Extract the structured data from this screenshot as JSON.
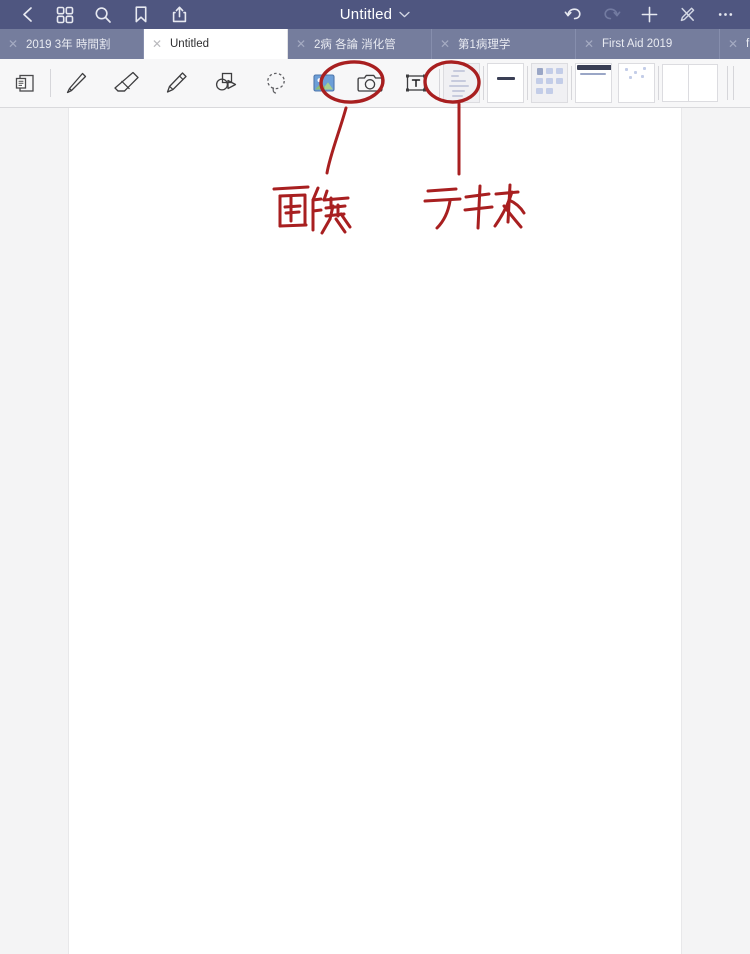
{
  "app": {
    "name": "Notability",
    "accent_topbar": "#4f5680",
    "accent_tabbar": "#757d9d",
    "annotation_color": "#b3201f"
  },
  "topbar": {
    "title": "Untitled",
    "title_chevron": "chevron-down-icon",
    "left_actions": [
      {
        "name": "back-button",
        "icon": "chevron-left-icon",
        "label": "Back"
      },
      {
        "name": "thumbnails-button",
        "icon": "grid-icon",
        "label": "Thumbnails"
      },
      {
        "name": "search-button",
        "icon": "search-icon",
        "label": "Search"
      },
      {
        "name": "bookmark-button",
        "icon": "bookmark-icon",
        "label": "Bookmark"
      },
      {
        "name": "share-button",
        "icon": "share-icon",
        "label": "Share"
      }
    ],
    "right_actions": [
      {
        "name": "undo-button",
        "icon": "undo-icon",
        "label": "Undo",
        "enabled": true
      },
      {
        "name": "redo-button",
        "icon": "redo-icon",
        "label": "Redo",
        "enabled": false
      },
      {
        "name": "add-button",
        "icon": "plus-icon",
        "label": "New Note"
      },
      {
        "name": "palm-rejection-button",
        "icon": "pen-disabled-icon",
        "label": "Stylus Off"
      },
      {
        "name": "more-button",
        "icon": "ellipsis-icon",
        "label": "More"
      }
    ]
  },
  "tabs": [
    {
      "label": "2019 3年 時間割",
      "active": false,
      "width": 144
    },
    {
      "label": "Untitled",
      "active": true,
      "width": 144
    },
    {
      "label": "2病 各論 消化管",
      "active": false,
      "width": 144
    },
    {
      "label": "第1病理学",
      "active": false,
      "width": 144
    },
    {
      "label": "First Aid 2019",
      "active": false,
      "width": 144
    },
    {
      "label": "fi",
      "active": false,
      "width": 40
    }
  ],
  "toolbar": {
    "tools": [
      {
        "name": "page-insert-tool",
        "icon": "page-insert-icon",
        "label": "Insert Page",
        "circled": false
      },
      {
        "name": "pen-tool",
        "icon": "pencil-icon",
        "label": "Pen",
        "circled": false
      },
      {
        "name": "eraser-tool",
        "icon": "eraser-icon",
        "label": "Eraser",
        "circled": false
      },
      {
        "name": "highlighter-tool",
        "icon": "highlighter-icon",
        "label": "Highlighter",
        "circled": false
      },
      {
        "name": "shape-tool",
        "icon": "shapes-icon",
        "label": "Shapes",
        "circled": false
      },
      {
        "name": "lasso-tool",
        "icon": "lasso-icon",
        "label": "Lasso",
        "circled": false
      },
      {
        "name": "image-tool",
        "icon": "image-icon",
        "label": "Image",
        "circled": true
      },
      {
        "name": "camera-tool",
        "icon": "camera-icon",
        "label": "Camera",
        "circled": false
      },
      {
        "name": "text-tool",
        "icon": "text-box-icon",
        "label": "Text",
        "circled": true
      }
    ],
    "thumbnails": [
      {
        "name": "template-thumb-notes",
        "kind": "lines",
        "selected": true
      },
      {
        "name": "template-thumb-blank",
        "kind": "bar",
        "selected": false
      },
      {
        "name": "template-thumb-grid",
        "kind": "blocks",
        "selected": true
      },
      {
        "name": "template-thumb-dark-header",
        "kind": "header",
        "selected": false
      },
      {
        "name": "template-thumb-scatter",
        "kind": "scatter",
        "selected": false
      },
      {
        "name": "template-thumb-pair",
        "kind": "pair",
        "selected": false
      }
    ]
  },
  "annotations": [
    {
      "name": "annotation-image-label",
      "text": "画像",
      "target": "image-tool",
      "kind": "handwriting"
    },
    {
      "name": "annotation-text-label",
      "text": "テキスト",
      "target": "text-tool",
      "kind": "handwriting"
    }
  ],
  "document": {
    "page_background": "#ffffff",
    "canvas_background": "#f4f4f5",
    "content": ""
  }
}
